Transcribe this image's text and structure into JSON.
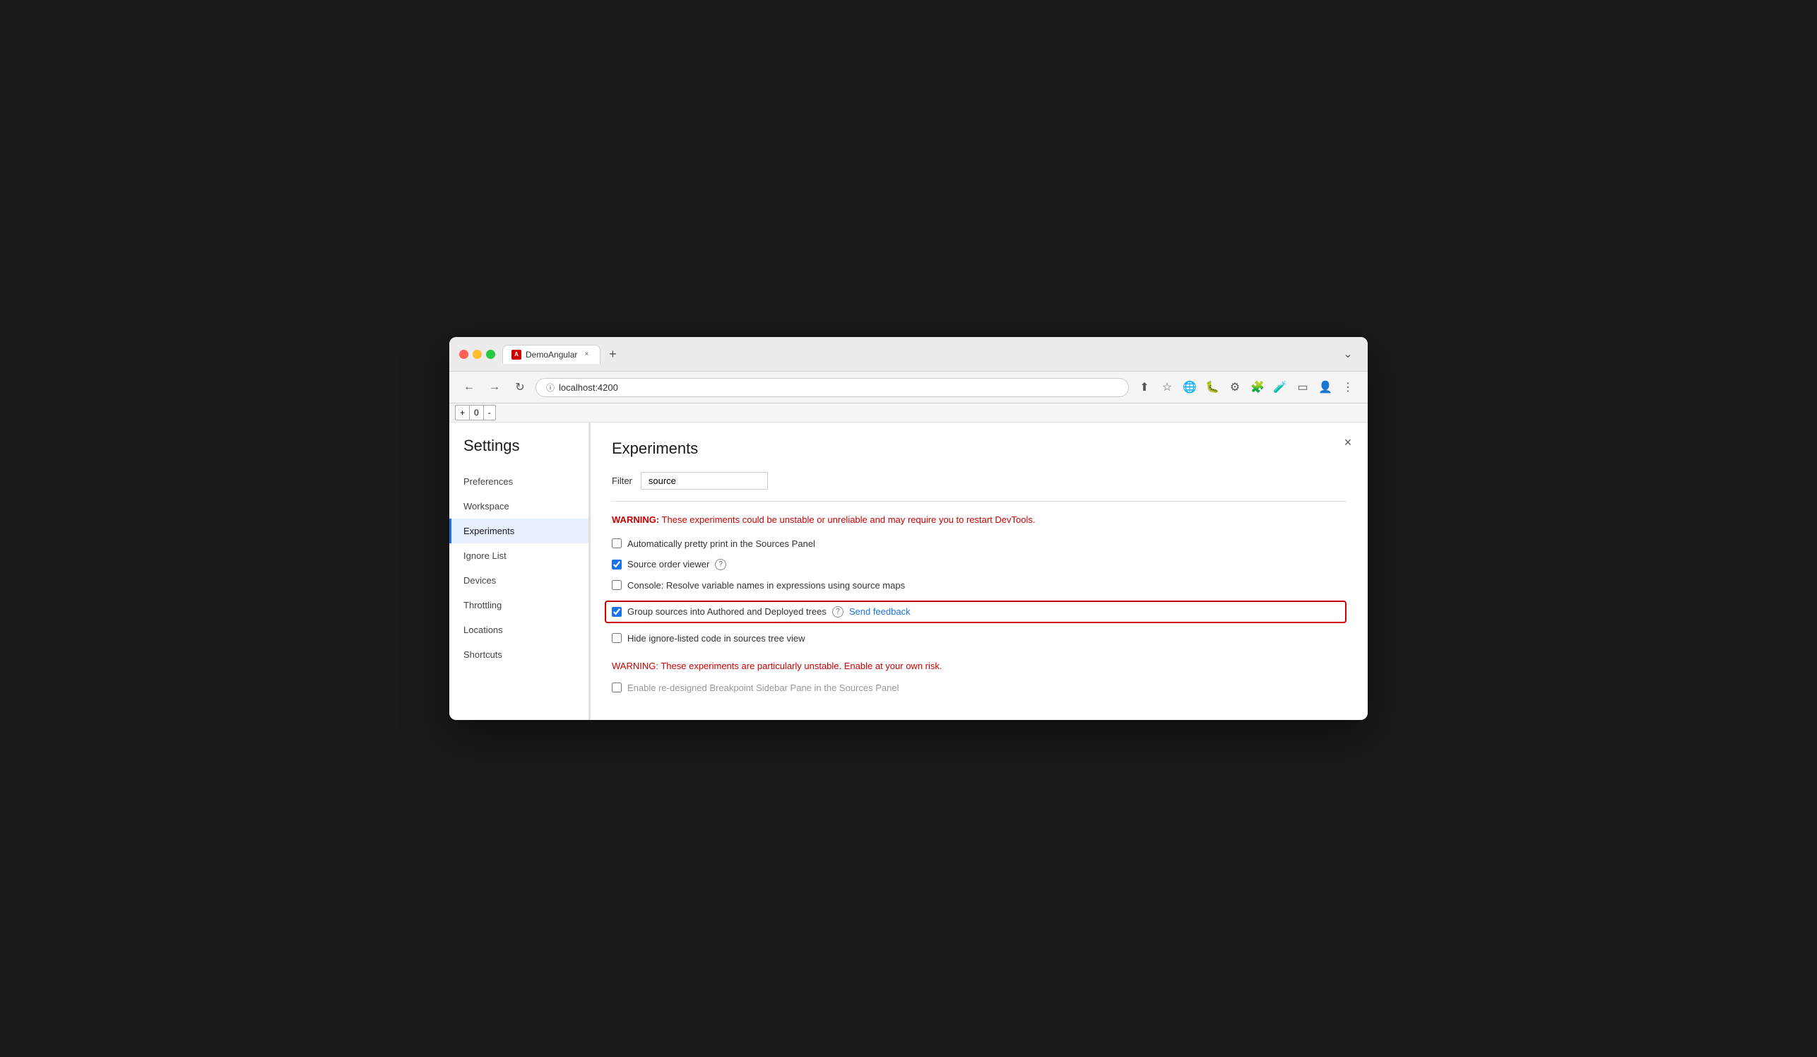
{
  "browser": {
    "tab_title": "DemoAngular",
    "tab_close_label": "×",
    "new_tab_label": "+",
    "address": "localhost:4200",
    "back_btn": "←",
    "forward_btn": "→",
    "refresh_btn": "↻",
    "dropdown_btn": "⌄"
  },
  "devtools": {
    "font_decrease": "+",
    "font_value": "0",
    "font_increase": "-",
    "close_label": "×"
  },
  "settings": {
    "title": "Settings",
    "nav_items": [
      {
        "id": "preferences",
        "label": "Preferences",
        "active": false
      },
      {
        "id": "workspace",
        "label": "Workspace",
        "active": false
      },
      {
        "id": "experiments",
        "label": "Experiments",
        "active": true
      },
      {
        "id": "ignore-list",
        "label": "Ignore List",
        "active": false
      },
      {
        "id": "devices",
        "label": "Devices",
        "active": false
      },
      {
        "id": "throttling",
        "label": "Throttling",
        "active": false
      },
      {
        "id": "locations",
        "label": "Locations",
        "active": false
      },
      {
        "id": "shortcuts",
        "label": "Shortcuts",
        "active": false
      }
    ],
    "content": {
      "title": "Experiments",
      "filter_label": "Filter",
      "filter_value": "source",
      "filter_placeholder": "",
      "warning1": "WARNING:",
      "warning1_text": " These experiments could be unstable or unreliable and may require you to restart DevTools.",
      "experiments": [
        {
          "id": "pretty-print",
          "label": "Automatically pretty print in the Sources Panel",
          "checked": false,
          "highlighted": false,
          "has_help": false,
          "has_feedback": false
        },
        {
          "id": "source-order",
          "label": "Source order viewer",
          "checked": true,
          "highlighted": false,
          "has_help": true,
          "has_feedback": false
        },
        {
          "id": "console-resolve",
          "label": "Console: Resolve variable names in expressions using source maps",
          "checked": false,
          "highlighted": false,
          "has_help": false,
          "has_feedback": false
        },
        {
          "id": "group-sources",
          "label": "Group sources into Authored and Deployed trees",
          "checked": true,
          "highlighted": true,
          "has_help": true,
          "has_feedback": true,
          "feedback_label": "Send feedback"
        },
        {
          "id": "hide-ignore",
          "label": "Hide ignore-listed code in sources tree view",
          "checked": false,
          "highlighted": false,
          "has_help": false,
          "has_feedback": false
        }
      ],
      "warning2": "WARNING:",
      "warning2_text": " These experiments are particularly unstable. Enable at your own risk.",
      "unstable_experiments": [
        {
          "id": "breakpoint-sidebar",
          "label": "Enable re-designed Breakpoint Sidebar Pane in the Sources Panel",
          "checked": false,
          "disabled": true
        }
      ]
    }
  }
}
